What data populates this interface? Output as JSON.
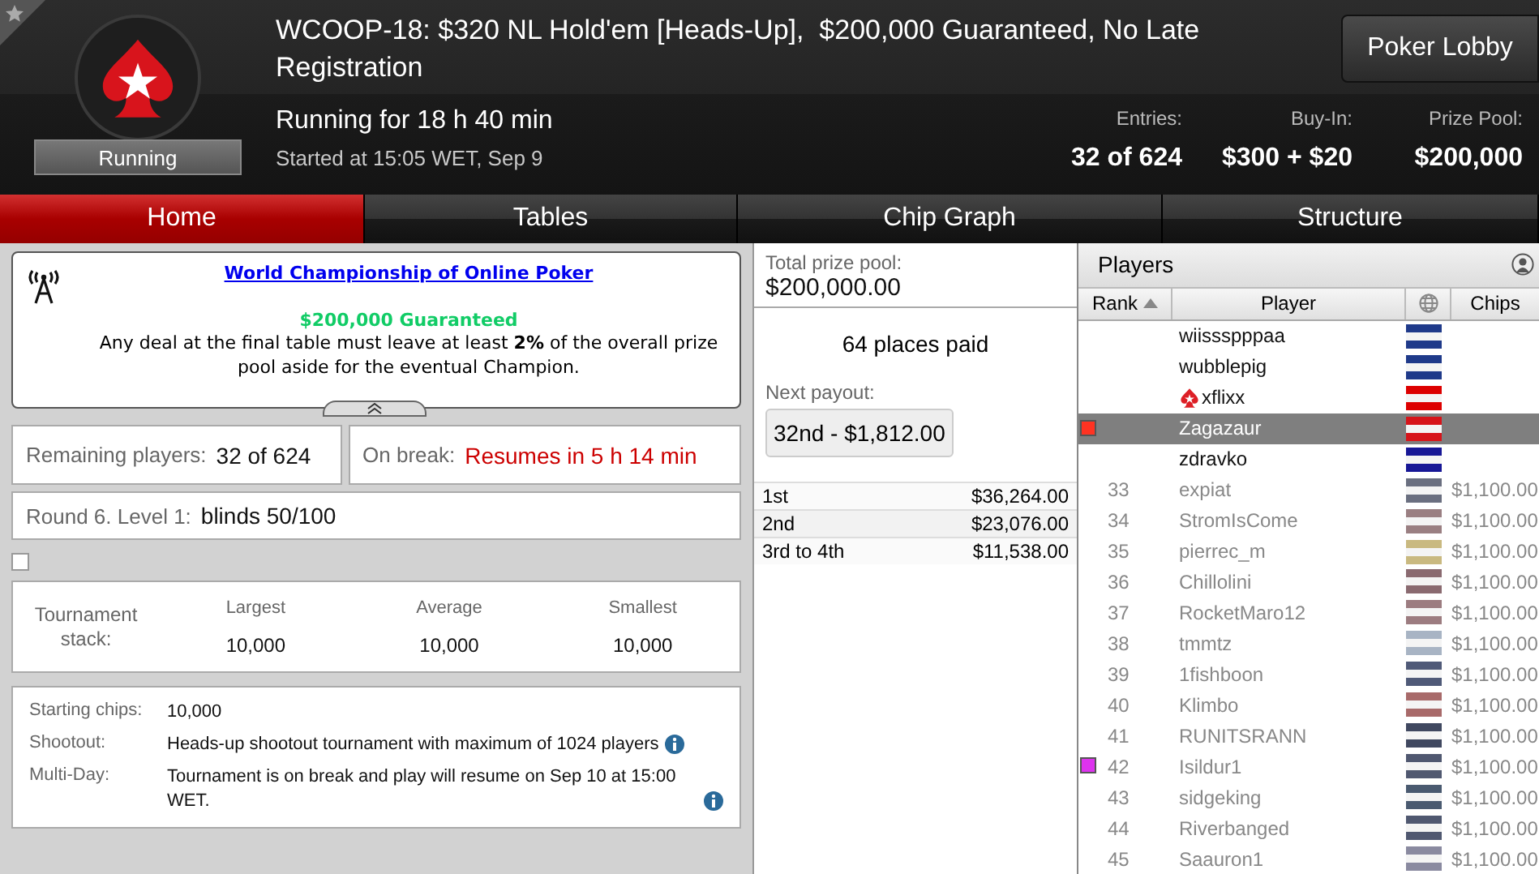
{
  "header": {
    "status": "Running",
    "title": "WCOOP-18: $320 NL Hold'em [Heads-Up],  $200,000 Guaranteed, No Late Registration",
    "lobby_button": "Poker Lobby",
    "running_for": "Running for 18 h 40 min",
    "started": "Started at 15:05 WET, Sep 9",
    "stats": [
      {
        "label": "Entries:",
        "value": "32 of 624"
      },
      {
        "label": "Buy-In:",
        "value": "$300 + $20"
      },
      {
        "label": "Prize Pool:",
        "value": "$200,000"
      }
    ]
  },
  "tabs": [
    {
      "label": "Home",
      "selected": true
    },
    {
      "label": "Tables",
      "selected": false
    },
    {
      "label": "Chip Graph",
      "selected": false
    },
    {
      "label": "Structure",
      "selected": false
    }
  ],
  "announcement": {
    "link": "World Championship of Online Poker",
    "highlight": "$200,000 Guaranteed",
    "text": "Any deal at the final table must leave at least **2%** of the overall prize pool aside for the eventual Champion."
  },
  "remaining": {
    "label": "Remaining players:",
    "value": "32 of 624"
  },
  "break": {
    "label": "On break:",
    "value": "Resumes in 5 h 14 min"
  },
  "level": {
    "label": "Round 6. Level 1:",
    "value": "blinds 50/100"
  },
  "stack_checkbox": {
    "checked": false
  },
  "stack": {
    "label": "Tournament stack:",
    "columns": [
      {
        "label": "Largest",
        "value": "10,000"
      },
      {
        "label": "Average",
        "value": "10,000"
      },
      {
        "label": "Smallest",
        "value": "10,000"
      }
    ]
  },
  "details": [
    {
      "label": "Starting chips:",
      "value": "10,000"
    },
    {
      "label": "Shootout:",
      "value": "Heads-up shootout tournament with maximum of 1024 players",
      "info": true
    },
    {
      "label": "Multi-Day:",
      "value": "Tournament is on break and play will resume on Sep 10 at 15:00 WET.",
      "info": true
    }
  ],
  "prizes": {
    "total_label": "Total prize pool:",
    "total": "$200,000.00",
    "places": "64 places paid",
    "next_label": "Next payout:",
    "next": "32nd - $1,812.00",
    "rows": [
      {
        "place": "1st",
        "amount": "$36,264.00"
      },
      {
        "place": "2nd",
        "amount": "$23,076.00"
      },
      {
        "place": "3rd to 4th",
        "amount": "$11,538.00"
      }
    ]
  },
  "players": {
    "title": "Players",
    "columns": [
      "Rank",
      "Player",
      "Chips"
    ],
    "rows": [
      {
        "rank": "",
        "name": "wiissspppaa",
        "chips": "",
        "eliminated": false,
        "selected": false,
        "team_pro": false,
        "flag": {
          "color": "#1f3a8a"
        }
      },
      {
        "rank": "",
        "name": "wubblepig",
        "chips": "",
        "eliminated": false,
        "selected": false,
        "team_pro": false,
        "flag": {
          "color": "#1f3a8a"
        }
      },
      {
        "rank": "",
        "name": "xflixx",
        "chips": "",
        "eliminated": false,
        "selected": false,
        "team_pro": true,
        "flag": {
          "color": "#dd0000"
        }
      },
      {
        "rank": "",
        "name": "Zagazaur",
        "chips": "",
        "eliminated": false,
        "selected": true,
        "team_pro": false,
        "marker": {
          "color": "#ff3322"
        },
        "flag": {
          "color": "#d7141a"
        }
      },
      {
        "rank": "",
        "name": "zdravko",
        "chips": "",
        "eliminated": false,
        "selected": false,
        "team_pro": false,
        "flag": {
          "color": "#171796"
        }
      },
      {
        "rank": "33",
        "name": "expiat",
        "chips": "$1,100.00",
        "eliminated": true,
        "selected": false,
        "team_pro": false,
        "flag": {
          "color": "#6a6f80"
        }
      },
      {
        "rank": "34",
        "name": "StromIsCome",
        "chips": "$1,100.00",
        "eliminated": true,
        "selected": false,
        "team_pro": false,
        "flag": {
          "color": "#9a7f82"
        }
      },
      {
        "rank": "35",
        "name": "pierrec_m",
        "chips": "$1,100.00",
        "eliminated": true,
        "selected": false,
        "team_pro": false,
        "flag": {
          "color": "#c9b980"
        }
      },
      {
        "rank": "36",
        "name": "Chillolini",
        "chips": "$1,100.00",
        "eliminated": true,
        "selected": false,
        "team_pro": false,
        "flag": {
          "color": "#8a6a70"
        }
      },
      {
        "rank": "37",
        "name": "RocketMaro12",
        "chips": "$1,100.00",
        "eliminated": true,
        "selected": false,
        "team_pro": false,
        "flag": {
          "color": "#9c7c80"
        }
      },
      {
        "rank": "38",
        "name": "tmmtz",
        "chips": "$1,100.00",
        "eliminated": true,
        "selected": false,
        "team_pro": false,
        "flag": {
          "color": "#a8b4c4"
        }
      },
      {
        "rank": "39",
        "name": "1fishboon",
        "chips": "$1,100.00",
        "eliminated": true,
        "selected": false,
        "team_pro": false,
        "flag": {
          "color": "#505a78"
        }
      },
      {
        "rank": "40",
        "name": "Klimbo",
        "chips": "$1,100.00",
        "eliminated": true,
        "selected": false,
        "team_pro": false,
        "flag": {
          "color": "#a86a6a"
        }
      },
      {
        "rank": "41",
        "name": "RUNITSRANN",
        "chips": "$1,100.00",
        "eliminated": true,
        "selected": false,
        "team_pro": false,
        "flag": {
          "color": "#404860"
        }
      },
      {
        "rank": "42",
        "name": "Isildur1",
        "chips": "$1,100.00",
        "eliminated": true,
        "selected": false,
        "team_pro": false,
        "marker": {
          "color": "#dd33ee"
        },
        "flag": {
          "color": "#505870"
        }
      },
      {
        "rank": "43",
        "name": "sidgeking",
        "chips": "$1,100.00",
        "eliminated": true,
        "selected": false,
        "team_pro": false,
        "flag": {
          "color": "#4a5a70"
        }
      },
      {
        "rank": "44",
        "name": "Riverbanged",
        "chips": "$1,100.00",
        "eliminated": true,
        "selected": false,
        "team_pro": false,
        "flag": {
          "color": "#505870"
        }
      },
      {
        "rank": "45",
        "name": "Saauron1",
        "chips": "$1,100.00",
        "eliminated": true,
        "selected": false,
        "team_pro": false,
        "flag": {
          "color": "#8a8aa0"
        }
      }
    ]
  }
}
